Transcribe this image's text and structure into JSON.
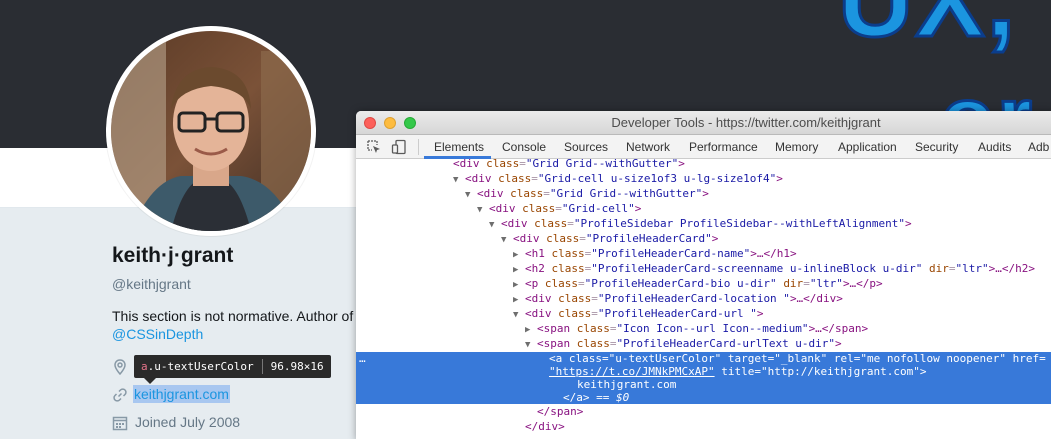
{
  "banner": {
    "text_big": "UX,",
    "text_small": "or"
  },
  "profile": {
    "name": "keith·j·grant",
    "handle": "@keithjgrant",
    "bio": "This section is not normative. Author of",
    "bio_link": "@CSSinDepth",
    "url": "keithjgrant.com",
    "joined": "Joined July 2008"
  },
  "tooltip": {
    "tag": "a",
    "class": ".u-textUserColor",
    "size": "96.98×16"
  },
  "devtools": {
    "title": "Developer Tools - https://twitter.com/keithjgrant",
    "tabs": [
      "Elements",
      "Console",
      "Sources",
      "Network",
      "Performance",
      "Memory",
      "Application",
      "Security",
      "Audits",
      "Adb"
    ],
    "active_tab": "Elements",
    "dom": {
      "l0": {
        "arrow": "",
        "tag": "<div ",
        "attr": "class",
        "val": "\"Grid Grid--withGutter\"",
        "close": ">"
      },
      "l1": {
        "arrow": "▼",
        "tag": "<div ",
        "attr": "class",
        "val": "\"Grid-cell u-size1of3 u-lg-size1of4\"",
        "close": ">"
      },
      "l2": {
        "arrow": "▼",
        "tag": "<div ",
        "attr": "class",
        "val": "\"Grid Grid--withGutter\"",
        "close": ">"
      },
      "l3": {
        "arrow": "▼",
        "tag": "<div ",
        "attr": "class",
        "val": "\"Grid-cell\"",
        "close": ">"
      },
      "l4": {
        "arrow": "▼",
        "tag": "<div ",
        "attr": "class",
        "val": "\"ProfileSidebar ProfileSidebar--withLeftAlignment\"",
        "close": ">"
      },
      "l5": {
        "arrow": "▼",
        "tag": "<div ",
        "attr": "class",
        "val": "\"ProfileHeaderCard\"",
        "close": ">"
      },
      "l6": {
        "arrow": "▶",
        "tag": "<h1 ",
        "attr": "class",
        "val": "\"ProfileHeaderCard-name\"",
        "close": ">…</h1>"
      },
      "l7": {
        "arrow": "▶",
        "tag": "<h2 ",
        "attr": "class",
        "val": "\"ProfileHeaderCard-screenname u-inlineBlock u-dir\"",
        "attr2": "dir",
        "val2": "\"ltr\"",
        "close": ">…</h2>"
      },
      "l8": {
        "arrow": "▶",
        "tag": "<p ",
        "attr": "class",
        "val": "\"ProfileHeaderCard-bio u-dir\"",
        "attr2": "dir",
        "val2": "\"ltr\"",
        "close": ">…</p>"
      },
      "l9": {
        "arrow": "▶",
        "tag": "<div ",
        "attr": "class",
        "val": "\"ProfileHeaderCard-location \"",
        "close": ">…</div>"
      },
      "l10": {
        "arrow": "▼",
        "tag": "<div ",
        "attr": "class",
        "val": "\"ProfileHeaderCard-url \"",
        "close": ">"
      },
      "l11": {
        "arrow": "▶",
        "tag": "<span ",
        "attr": "class",
        "val": "\"Icon Icon--url Icon--medium\"",
        "close": ">…</span>"
      },
      "l12": {
        "arrow": "▼",
        "tag": "<span ",
        "attr": "class",
        "val": "\"ProfileHeaderCard-urlText u-dir\"",
        "close": ">"
      },
      "sel1": {
        "tag": "<a ",
        "attr": "class",
        "val": "\"u-textUserColor\"",
        "attr2": "target",
        "val2": "\"_blank\"",
        "attr3": "rel",
        "val3": "\"me nofollow noopener\"",
        "attr4": "href="
      },
      "sel2": {
        "val": "\"https://t.co/JMNkPMCxAP\"",
        "attr": "title",
        "val2": "\"http://keithjgrant.com\"",
        "close": ">"
      },
      "sel3": {
        "text": "keithjgrant.com"
      },
      "sel4": {
        "close": "</a>",
        "eq": "== $0"
      },
      "l13": {
        "close": "</span>"
      },
      "l14": {
        "close": "</div>"
      },
      "dots": "…"
    }
  }
}
